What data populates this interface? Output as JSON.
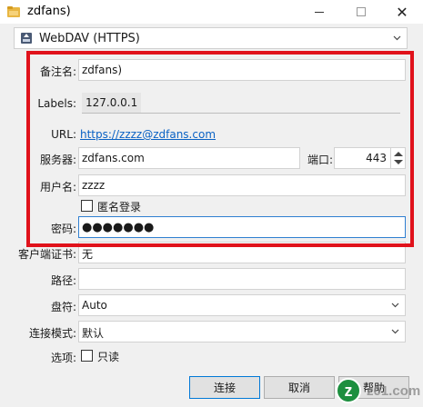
{
  "window": {
    "title": "zdfans)"
  },
  "protocol": {
    "selected": "WebDAV (HTTPS)"
  },
  "form": {
    "nickname_label": "备注名:",
    "nickname_value": "zdfans)",
    "labels_label": "Labels:",
    "labels_value": "127.0.0.1",
    "url_label": "URL:",
    "url_value": "https://zzzz@zdfans.com",
    "server_label": "服务器:",
    "server_value": "zdfans.com",
    "port_label": "端口:",
    "port_value": "443",
    "username_label": "用户名:",
    "username_value": "zzzz",
    "anonymous_label": "匿名登录",
    "password_label": "密码:",
    "password_value": "●●●●●●●",
    "client_cert_label": "客户端证书:",
    "client_cert_value": "无",
    "path_label": "路径:",
    "path_value": "",
    "encoding_label": "盘符:",
    "encoding_value": "Auto",
    "connect_mode_label": "连接模式:",
    "connect_mode_value": "默认",
    "options_label": "选项:",
    "readonly_label": "只读"
  },
  "buttons": {
    "connect": "连接",
    "cancel": "取消",
    "help": "帮助"
  },
  "watermark": {
    "logo": "z",
    "text": "z01.com"
  },
  "colors": {
    "highlight_border": "#e0121b",
    "link": "#0a62c4",
    "focus": "#2f7fd1"
  },
  "icons": {
    "title": "disk-folder-icon",
    "protocol": "webdav-drive-icon",
    "dropdown": "chevron-down-icon"
  }
}
